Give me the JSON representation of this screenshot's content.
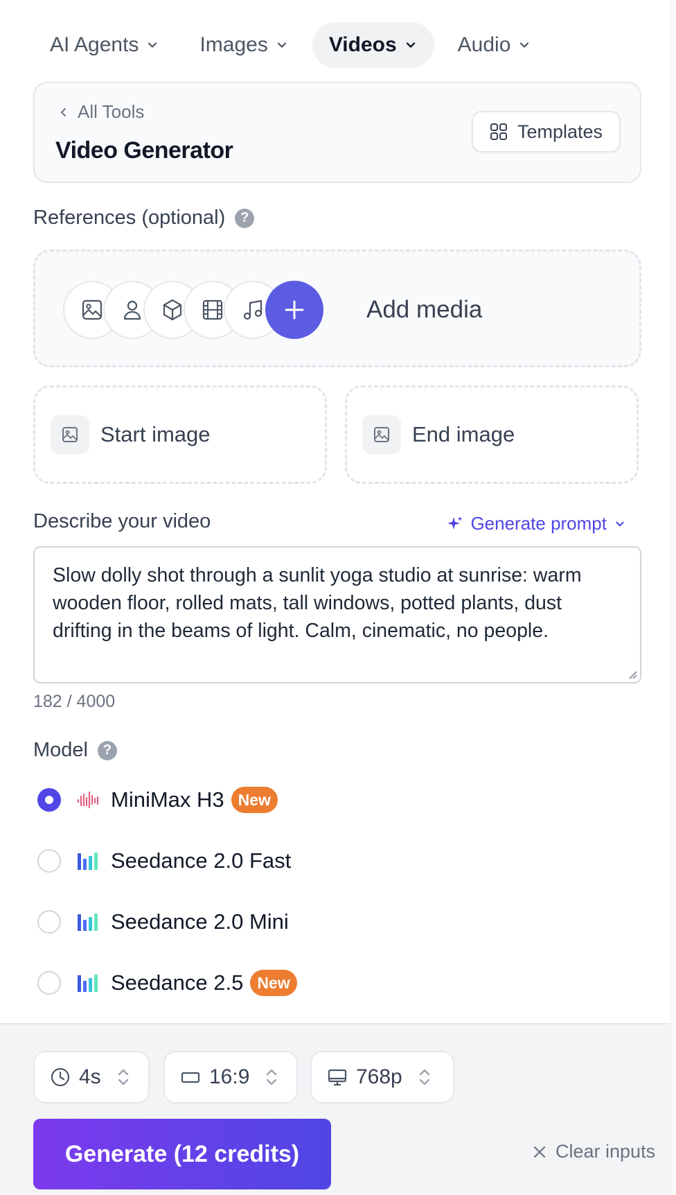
{
  "nav": {
    "items": [
      {
        "label": "AI Agents"
      },
      {
        "label": "Images"
      },
      {
        "label": "Videos",
        "active": true
      },
      {
        "label": "Audio"
      }
    ]
  },
  "header": {
    "back_label": "All Tools",
    "title": "Video Generator",
    "templates_label": "Templates"
  },
  "references": {
    "label": "References (optional)",
    "help": "?",
    "add_media_label": "Add media",
    "icons": [
      "image-icon",
      "person-icon",
      "cube-icon",
      "film-icon",
      "music-icon"
    ]
  },
  "frames": {
    "start_label": "Start image",
    "end_label": "End image"
  },
  "prompt": {
    "label": "Describe your video",
    "generate_prompt_label": "Generate prompt",
    "value": "Slow dolly shot through a sunlit yoga studio at sunrise: warm wooden floor, rolled mats, tall windows, potted plants, dust drifting in the beams of light. Calm, cinematic, no people.",
    "char_count": "182 / 4000"
  },
  "model": {
    "label": "Model",
    "help": "?",
    "options": [
      {
        "name": "MiniMax H3",
        "badge": "New",
        "selected": true
      },
      {
        "name": "Seedance 2.0 Fast",
        "badge": "",
        "selected": false
      },
      {
        "name": "Seedance 2.0 Mini",
        "badge": "",
        "selected": false
      },
      {
        "name": "Seedance 2.5",
        "badge": "New",
        "selected": false
      }
    ]
  },
  "settings": {
    "duration": "4s",
    "aspect_ratio": "16:9",
    "resolution": "768p"
  },
  "actions": {
    "generate_label": "Generate (12 credits)",
    "clear_label": "Clear inputs"
  },
  "colors": {
    "accent": "#4f46e5",
    "add_button": "#5b5ce2",
    "badge": "#ed7d31",
    "generate_gradient_start": "#7c3aed",
    "generate_gradient_end": "#4f46e5"
  }
}
